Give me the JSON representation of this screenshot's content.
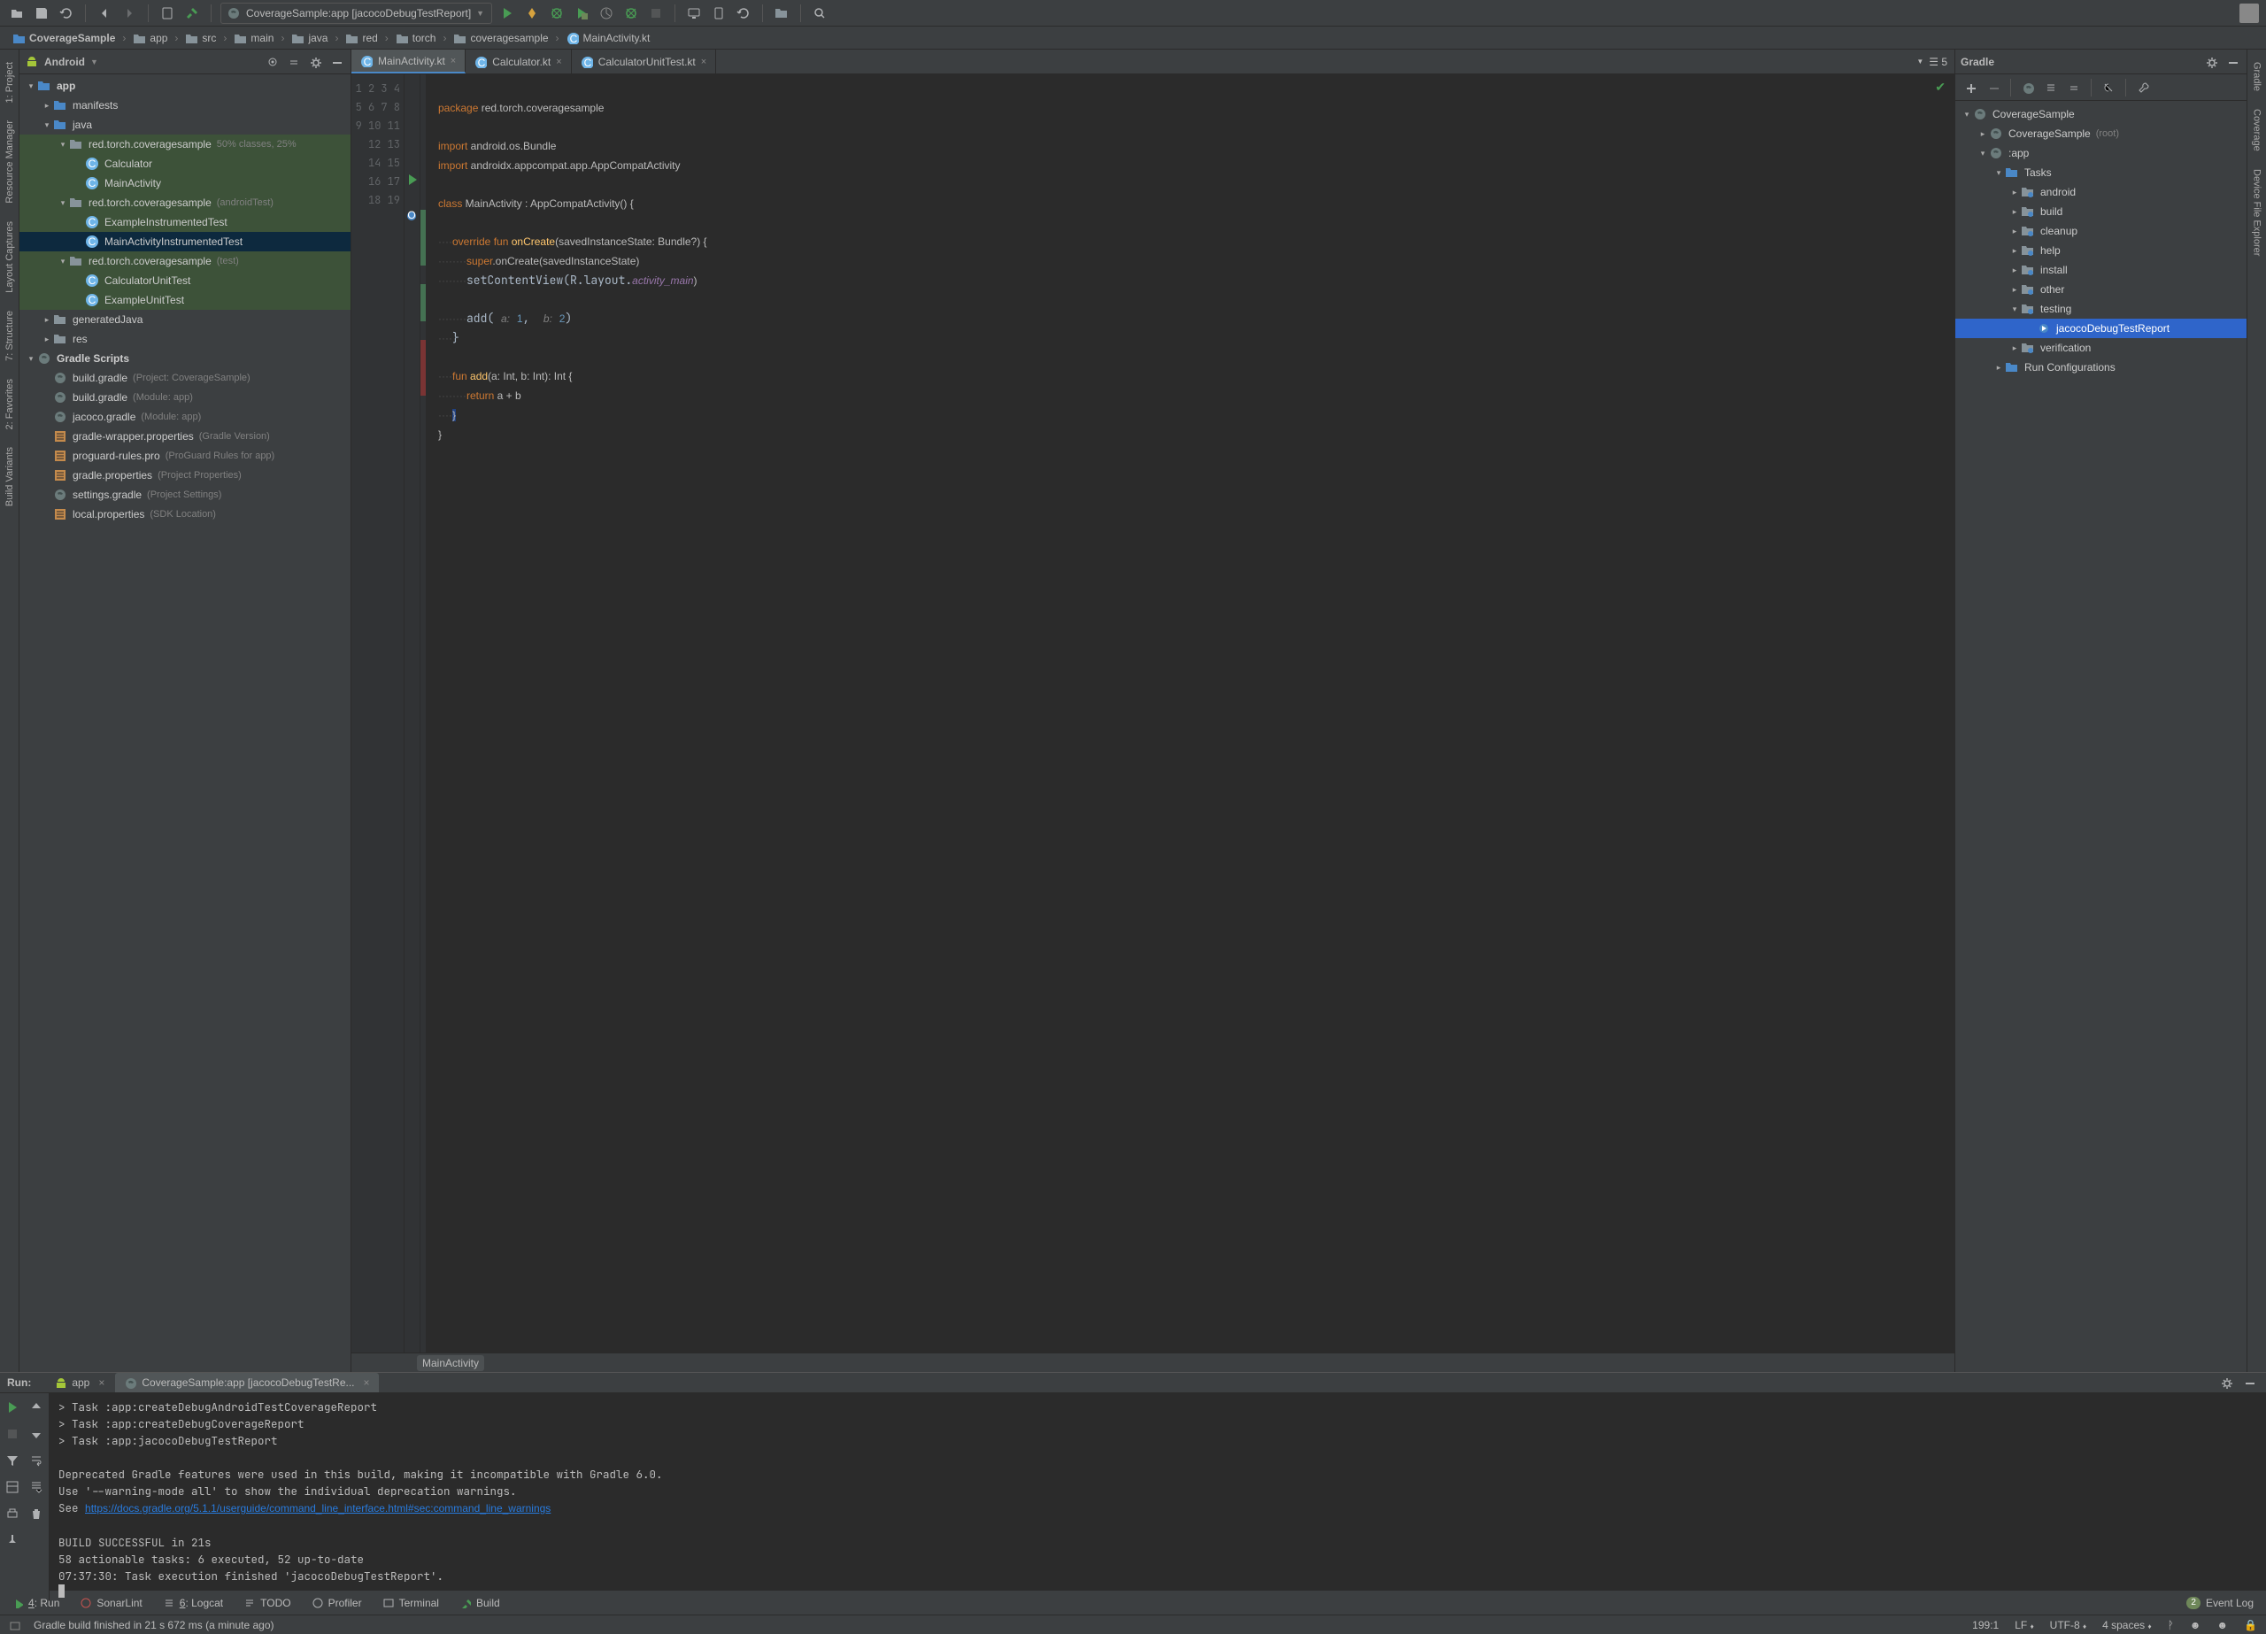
{
  "toolbar": {
    "run_config": "CoverageSample:app [jacocoDebugTestReport]"
  },
  "breadcrumbs": [
    "CoverageSample",
    "app",
    "src",
    "main",
    "java",
    "red",
    "torch",
    "coveragesample",
    "MainActivity.kt"
  ],
  "project_panel": {
    "mode": "Android",
    "items": [
      {
        "level": 0,
        "arrow": "▾",
        "icon": "module",
        "label": "app",
        "bold": true
      },
      {
        "level": 1,
        "arrow": "▸",
        "icon": "folder",
        "label": "manifests"
      },
      {
        "level": 1,
        "arrow": "▾",
        "icon": "folder",
        "label": "java"
      },
      {
        "level": 2,
        "arrow": "▾",
        "icon": "pkg",
        "label": "red.torch.coveragesample",
        "hint": "50% classes, 25%",
        "hl": true
      },
      {
        "level": 3,
        "arrow": "",
        "icon": "kt-class",
        "label": "Calculator",
        "hl": true
      },
      {
        "level": 3,
        "arrow": "",
        "icon": "kt-class",
        "label": "MainActivity",
        "hl": true
      },
      {
        "level": 2,
        "arrow": "▾",
        "icon": "pkg",
        "label": "red.torch.coveragesample",
        "hint": "(androidTest)",
        "hl": true
      },
      {
        "level": 3,
        "arrow": "",
        "icon": "kt-class",
        "label": "ExampleInstrumentedTest",
        "hl": true
      },
      {
        "level": 3,
        "arrow": "",
        "icon": "kt-class",
        "label": "MainActivityInstrumentedTest",
        "selected": true
      },
      {
        "level": 2,
        "arrow": "▾",
        "icon": "pkg",
        "label": "red.torch.coveragesample",
        "hint": "(test)",
        "hl": true
      },
      {
        "level": 3,
        "arrow": "",
        "icon": "kt-class",
        "label": "CalculatorUnitTest",
        "hl": true
      },
      {
        "level": 3,
        "arrow": "",
        "icon": "kt-class",
        "label": "ExampleUnitTest",
        "hl": true
      },
      {
        "level": 1,
        "arrow": "▸",
        "icon": "gen",
        "label": "generatedJava"
      },
      {
        "level": 1,
        "arrow": "▸",
        "icon": "res",
        "label": "res"
      },
      {
        "level": 0,
        "arrow": "▾",
        "icon": "gradle-group",
        "label": "Gradle Scripts",
        "bold": true
      },
      {
        "level": 1,
        "arrow": "",
        "icon": "gradle",
        "label": "build.gradle",
        "hint": "(Project: CoverageSample)"
      },
      {
        "level": 1,
        "arrow": "",
        "icon": "gradle",
        "label": "build.gradle",
        "hint": "(Module: app)"
      },
      {
        "level": 1,
        "arrow": "",
        "icon": "gradle",
        "label": "jacoco.gradle",
        "hint": "(Module: app)"
      },
      {
        "level": 1,
        "arrow": "",
        "icon": "props",
        "label": "gradle-wrapper.properties",
        "hint": "(Gradle Version)"
      },
      {
        "level": 1,
        "arrow": "",
        "icon": "props",
        "label": "proguard-rules.pro",
        "hint": "(ProGuard Rules for app)"
      },
      {
        "level": 1,
        "arrow": "",
        "icon": "props",
        "label": "gradle.properties",
        "hint": "(Project Properties)"
      },
      {
        "level": 1,
        "arrow": "",
        "icon": "gradle",
        "label": "settings.gradle",
        "hint": "(Project Settings)"
      },
      {
        "level": 1,
        "arrow": "",
        "icon": "props",
        "label": "local.properties",
        "hint": "(SDK Location)"
      }
    ]
  },
  "editor": {
    "tabs": [
      {
        "name": "MainActivity.kt",
        "active": true
      },
      {
        "name": "Calculator.kt",
        "active": false
      },
      {
        "name": "CalculatorUnitTest.kt",
        "active": false
      }
    ],
    "tab_info": "☰ 5",
    "lines": 19,
    "coverage": {
      "8": "green",
      "9": "green",
      "10": "green",
      "12": "green",
      "13": "green",
      "15": "red",
      "16": "red",
      "17": "red"
    },
    "breadcrumb_bottom": "MainActivity"
  },
  "code": {
    "l1a": "package",
    "l1b": " red.torch.coveragesample",
    "l3a": "import",
    "l3b": " android.os.Bundle",
    "l4a": "import",
    "l4b": " androidx.appcompat.app.AppCompatActivity",
    "l6a": "class",
    "l6b": " MainActivity : AppCompatActivity() {",
    "l8a": "    ",
    "l8b": "override",
    "l8c": " ",
    "l8d": "fun",
    "l8e": " ",
    "l8f": "onCreate",
    "l8g": "(savedInstanceState: Bundle?) {",
    "l9a": "        ",
    "l9b": "super",
    "l9c": ".onCreate(savedInstanceState)",
    "l10a": "        setContentView(R.layout.",
    "l10b": "activity_main",
    "l10c": ")",
    "l12a": "        add( ",
    "l12b": "a:",
    "l12c": " ",
    "l12d": "1",
    "l12e": ",  ",
    "l12f": "b:",
    "l12g": " ",
    "l12h": "2",
    "l12i": ")",
    "l13": "    }",
    "l15a": "    ",
    "l15b": "fun",
    "l15c": " ",
    "l15d": "add",
    "l15e": "(a: Int, b: Int): Int {",
    "l16a": "        ",
    "l16b": "return",
    "l16c": " a + b",
    "l17": "    }",
    "l18": "}"
  },
  "gradle": {
    "title": "Gradle",
    "items": [
      {
        "level": 0,
        "arrow": "▾",
        "icon": "gradle",
        "label": "CoverageSample"
      },
      {
        "level": 1,
        "arrow": "▸",
        "icon": "gradle",
        "label": "CoverageSample",
        "hint": "(root)"
      },
      {
        "level": 1,
        "arrow": "▾",
        "icon": "gradle",
        "label": ":app"
      },
      {
        "level": 2,
        "arrow": "▾",
        "icon": "folder-tasks",
        "label": "Tasks"
      },
      {
        "level": 3,
        "arrow": "▸",
        "icon": "task-group",
        "label": "android"
      },
      {
        "level": 3,
        "arrow": "▸",
        "icon": "task-group",
        "label": "build"
      },
      {
        "level": 3,
        "arrow": "▸",
        "icon": "task-group",
        "label": "cleanup"
      },
      {
        "level": 3,
        "arrow": "▸",
        "icon": "task-group",
        "label": "help"
      },
      {
        "level": 3,
        "arrow": "▸",
        "icon": "task-group",
        "label": "install"
      },
      {
        "level": 3,
        "arrow": "▸",
        "icon": "task-group",
        "label": "other"
      },
      {
        "level": 3,
        "arrow": "▾",
        "icon": "task-group",
        "label": "testing"
      },
      {
        "level": 4,
        "arrow": "",
        "icon": "task",
        "label": "jacocoDebugTestReport",
        "selected": true
      },
      {
        "level": 3,
        "arrow": "▸",
        "icon": "task-group",
        "label": "verification"
      },
      {
        "level": 2,
        "arrow": "▸",
        "icon": "folder-tasks",
        "label": "Run Configurations"
      }
    ]
  },
  "run": {
    "title": "Run:",
    "tabs": [
      {
        "name": "app",
        "icon": "android"
      },
      {
        "name": "CoverageSample:app [jacocoDebugTestRe...",
        "icon": "gradle",
        "active": true
      }
    ],
    "console_lines": [
      "> Task :app:createDebugAndroidTestCoverageReport",
      "> Task :app:createDebugCoverageReport",
      "> Task :app:jacocoDebugTestReport",
      "",
      "Deprecated Gradle features were used in this build, making it incompatible with Gradle 6.0.",
      "Use '--warning-mode all' to show the individual deprecation warnings."
    ],
    "see_prefix": "See ",
    "see_link": "https://docs.gradle.org/5.1.1/userguide/command_line_interface.html#sec:command_line_warnings",
    "final_lines": [
      "",
      "BUILD SUCCESSFUL in 21s",
      "58 actionable tasks: 6 executed, 52 up-to-date",
      "07:37:30: Task execution finished 'jacocoDebugTestReport'."
    ]
  },
  "bottom_tabs": {
    "run": "4: Run",
    "sonar": "SonarLint",
    "logcat": "6: Logcat",
    "todo": "TODO",
    "profiler": "Profiler",
    "terminal": "Terminal",
    "build": "Build",
    "event": "Event Log",
    "event_count": "2"
  },
  "status": {
    "message": "Gradle build finished in 21 s 672 ms (a minute ago)",
    "position": "199:1",
    "line_sep": "LF",
    "encoding": "UTF-8",
    "indent": "4 spaces"
  },
  "left_gutter_tabs": [
    "1: Project",
    "Resource Manager",
    "Layout Captures",
    "7: Structure",
    "2: Favorites",
    "Build Variants"
  ],
  "right_gutter_tabs": [
    "Gradle",
    "Coverage",
    "Device File Explorer"
  ]
}
